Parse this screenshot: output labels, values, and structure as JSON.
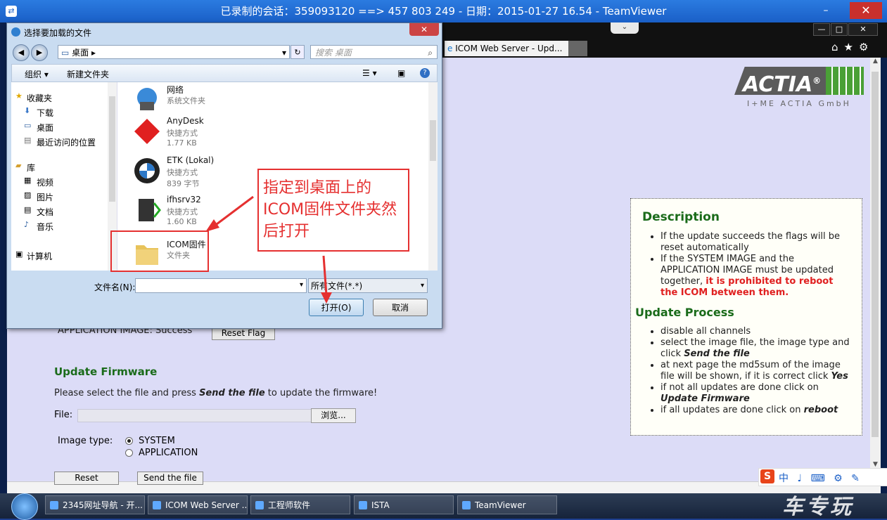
{
  "teamviewer": {
    "title": "已录制的会话：359093120 ==> 457 803 249 - 日期：2015-01-27 16.54 - TeamViewer",
    "minimize": "–",
    "restore": "▭",
    "close": "✕",
    "dropdown": "⌄"
  },
  "ie": {
    "tab_label": "ICOM Web Server - Upd...",
    "win_min": "—",
    "win_max": "□",
    "win_close": "✕",
    "toolbar_icons": "⌂★⚙"
  },
  "actia": {
    "brand": "ACTIA",
    "registered": "®",
    "subtitle": "I+ME ACTIA GmbH"
  },
  "description": {
    "title": "Description",
    "items": [
      "If the update succeeds the flags will be reset automatically",
      "If the SYSTEM IMAGE and the APPLICATION IMAGE must be updated together,",
      "it is prohibited to reboot the ICOM between them."
    ],
    "process_title": "Update Process",
    "process_items": [
      "disable all channels",
      "select the image file, the image type and click",
      "Send the file",
      "at next page the md5sum of the image file will be shown, if it is correct click",
      "Yes",
      "if not all updates are done click on",
      "Update Firmware",
      "if all updates are done click on",
      "reboot"
    ]
  },
  "page": {
    "app_image_label": "APPLICATION IMAGE:   Success",
    "reset_flag": "Reset Flag",
    "update_title": "Update Firmware",
    "update_text_a": "Please select the file and press ",
    "update_text_b": "Send the file",
    "update_text_c": " to update the firmware!",
    "file_label": "File:",
    "browse": "浏览...",
    "image_type_label": "Image type:",
    "image_types": [
      "SYSTEM",
      "APPLICATION"
    ],
    "reset_btn": "Reset",
    "send_btn": "Send the file"
  },
  "dialog": {
    "title": "选择要加载的文件",
    "close": "✕",
    "back": "◀",
    "forward": "▶",
    "address": "桌面  ▸",
    "address_dropdown": "▾",
    "refresh": "↻",
    "search_placeholder": "搜索 桌面",
    "organize": "组织 ▾",
    "new_folder": "新建文件夹",
    "view_icon": "☰ ▾",
    "help_icon": "?",
    "nav": {
      "favorites": "收藏夹",
      "downloads": "下载",
      "desktop": "桌面",
      "recent": "最近访问的位置",
      "libraries": "库",
      "videos": "视频",
      "pictures": "图片",
      "documents": "文档",
      "music": "音乐",
      "computer": "计算机"
    },
    "files": [
      {
        "name": "网络",
        "line1": "系统文件夹",
        "line2": ""
      },
      {
        "name": "AnyDesk",
        "line1": "快捷方式",
        "line2": "1.77 KB"
      },
      {
        "name": "ETK (Lokal)",
        "line1": "快捷方式",
        "line2": "839 字节"
      },
      {
        "name": "ifhsrv32",
        "line1": "快捷方式",
        "line2": "1.60 KB"
      },
      {
        "name": "ICOM固件",
        "line1": "文件夹",
        "line2": ""
      }
    ],
    "filename_label": "文件名(N):",
    "filetype": "所有文件(*.*)",
    "open_btn": "打开(O)",
    "cancel_btn": "取消"
  },
  "annotation": {
    "note": "指定到桌面上的ICOM固件文件夹然后打开"
  },
  "taskbar": {
    "items": [
      "2345网址导航 - 开...",
      "ICOM Web Server ...",
      "工程师软件",
      "ISTA",
      "TeamViewer"
    ]
  },
  "ime": {
    "logo": "S",
    "items": "中 ♩ ⌨ ⚙ ✎"
  },
  "watermark": "车专玩"
}
